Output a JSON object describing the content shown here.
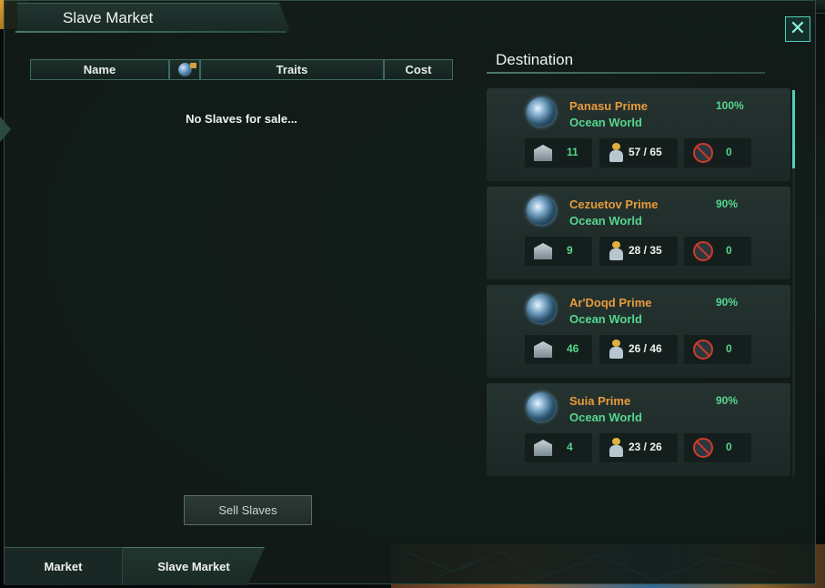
{
  "window": {
    "title": "Slave Market",
    "close_label": "✕"
  },
  "table": {
    "headers": {
      "name": "Name",
      "traits": "Traits",
      "cost": "Cost"
    },
    "empty_message": "No Slaves for sale..."
  },
  "sell_button_label": "Sell Slaves",
  "tabs": [
    {
      "label": "Market"
    },
    {
      "label": "Slave Market"
    }
  ],
  "destination": {
    "title": "Destination",
    "planets": [
      {
        "name": "Panasu Prime",
        "type": "Ocean World",
        "habitability": "100%",
        "housing": "11",
        "pops": "57 / 65",
        "restricted": "0"
      },
      {
        "name": "Cezuetov Prime",
        "type": "Ocean World",
        "habitability": "90%",
        "housing": "9",
        "pops": "28 / 35",
        "restricted": "0"
      },
      {
        "name": "Ar'Doqd Prime",
        "type": "Ocean World",
        "habitability": "90%",
        "housing": "46",
        "pops": "26 / 46",
        "restricted": "0"
      },
      {
        "name": "Suia Prime",
        "type": "Ocean World",
        "habitability": "90%",
        "housing": "4",
        "pops": "23 / 26",
        "restricted": "0"
      }
    ]
  },
  "colors": {
    "planet_name": "#e89b3a",
    "planet_type": "#56d68e",
    "accent": "#4fd0b8",
    "restriction_icon": "#d23a2a"
  },
  "icons": {
    "header_icon": "planet-icon",
    "housing": "housing-icon",
    "pops": "pop-icon",
    "restricted": "no-resettle-icon",
    "close": "close-icon"
  }
}
